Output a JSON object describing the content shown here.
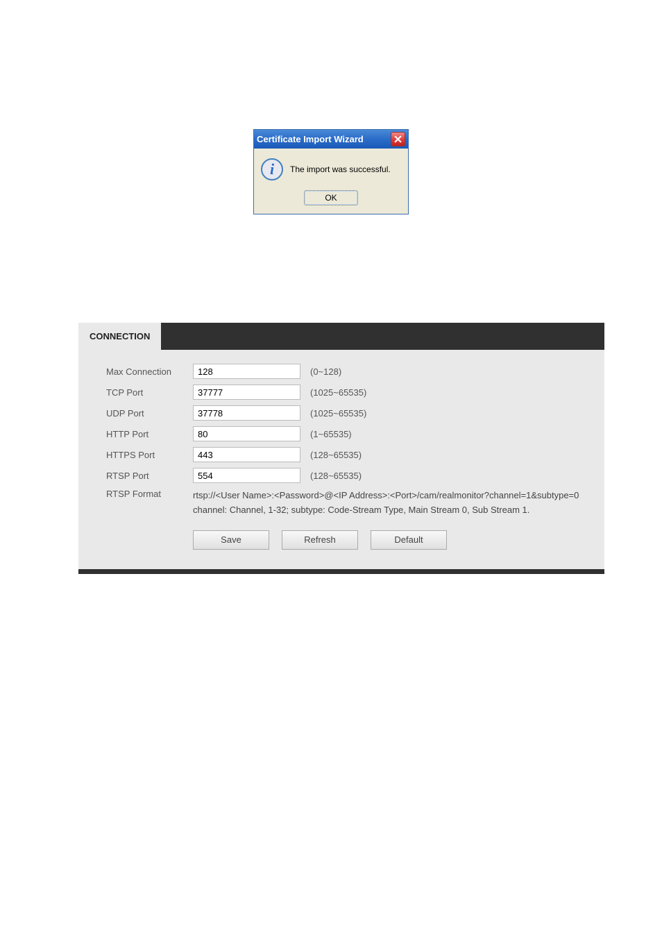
{
  "dialog": {
    "title": "Certificate Import Wizard",
    "message": "The import was successful.",
    "ok_label": "OK"
  },
  "panel": {
    "tab": "CONNECTION",
    "rows": [
      {
        "label": "Max Connection",
        "value": "128",
        "hint": "(0~128)"
      },
      {
        "label": "TCP Port",
        "value": "37777",
        "hint": "(1025~65535)"
      },
      {
        "label": "UDP Port",
        "value": "37778",
        "hint": "(1025~65535)"
      },
      {
        "label": "HTTP Port",
        "value": "80",
        "hint": "(1~65535)"
      },
      {
        "label": "HTTPS Port",
        "value": "443",
        "hint": "(128~65535)"
      },
      {
        "label": "RTSP Port",
        "value": "554",
        "hint": "(128~65535)"
      }
    ],
    "rtsp_format_label": "RTSP Format",
    "rtsp_line1": "rtsp://<User Name>:<Password>@<IP Address>:<Port>/cam/realmonitor?channel=1&subtype=0",
    "rtsp_line2": "channel: Channel, 1-32; subtype: Code-Stream Type, Main Stream 0, Sub Stream 1.",
    "buttons": {
      "save": "Save",
      "refresh": "Refresh",
      "default": "Default"
    }
  }
}
